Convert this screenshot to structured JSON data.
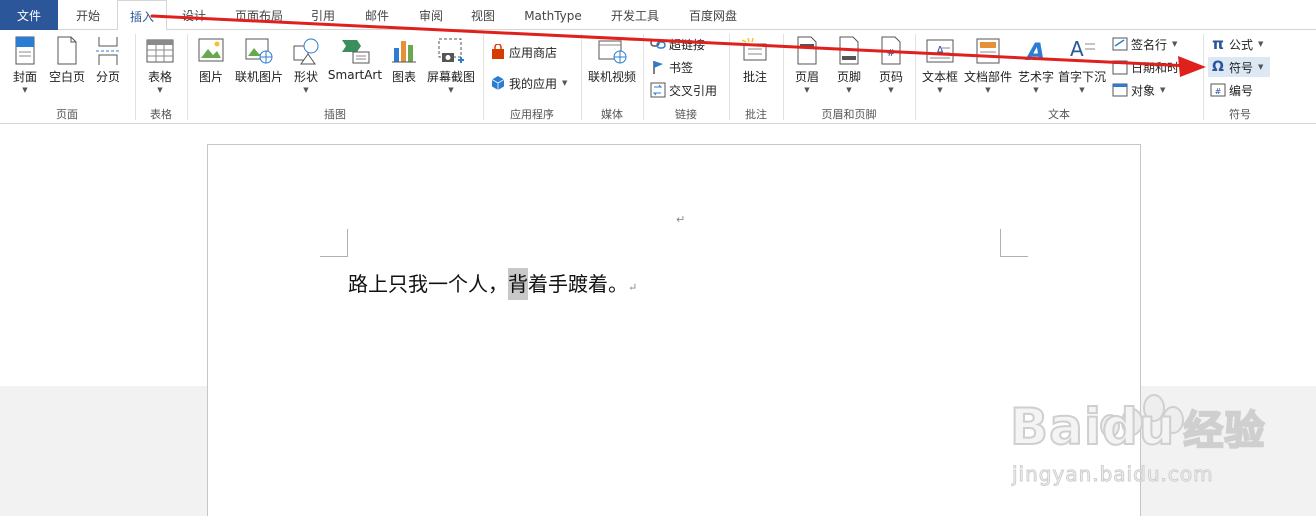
{
  "tabs": [
    "文件",
    "开始",
    "插入",
    "设计",
    "页面布局",
    "引用",
    "邮件",
    "审阅",
    "视图",
    "MathType",
    "开发工具",
    "百度网盘"
  ],
  "ribbon": {
    "pages": {
      "group": "页面",
      "cover": "封面",
      "blank": "空白页",
      "break": "分页"
    },
    "tables": {
      "group": "表格",
      "table": "表格"
    },
    "illustrations": {
      "group": "插图",
      "picture": "图片",
      "online_picture": "联机图片",
      "shapes": "形状",
      "smartart": "SmartArt",
      "chart": "图表",
      "screenshot": "屏幕截图"
    },
    "apps": {
      "group": "应用程序",
      "store": "应用商店",
      "my_apps": "我的应用"
    },
    "media": {
      "group": "媒体",
      "online_video": "联机视频"
    },
    "links": {
      "group": "链接",
      "hyperlink": "超链接",
      "bookmark": "书签",
      "cross_ref": "交叉引用"
    },
    "comments": {
      "group": "批注",
      "comment": "批注"
    },
    "header_footer": {
      "group": "页眉和页脚",
      "header": "页眉",
      "footer": "页脚",
      "page_number": "页码"
    },
    "text": {
      "group": "文本",
      "textbox": "文本框",
      "quick_parts": "文档部件",
      "wordart": "艺术字",
      "dropcap": "首字下沉",
      "signature": "签名行",
      "datetime": "日期和时间",
      "object": "对象"
    },
    "symbols": {
      "group": "符号",
      "equation": "公式",
      "symbol": "符号",
      "number": "编号"
    }
  },
  "document": {
    "before": "路上只我一个人，",
    "selected": "背",
    "after": "着手踱着。",
    "para_mark": "↵"
  },
  "watermark": {
    "brand": "Baidu",
    "brand_cn": "经验",
    "url": "jingyan.baidu.com"
  },
  "colors": {
    "accent": "#2b579a",
    "arrow": "#e0201c"
  }
}
